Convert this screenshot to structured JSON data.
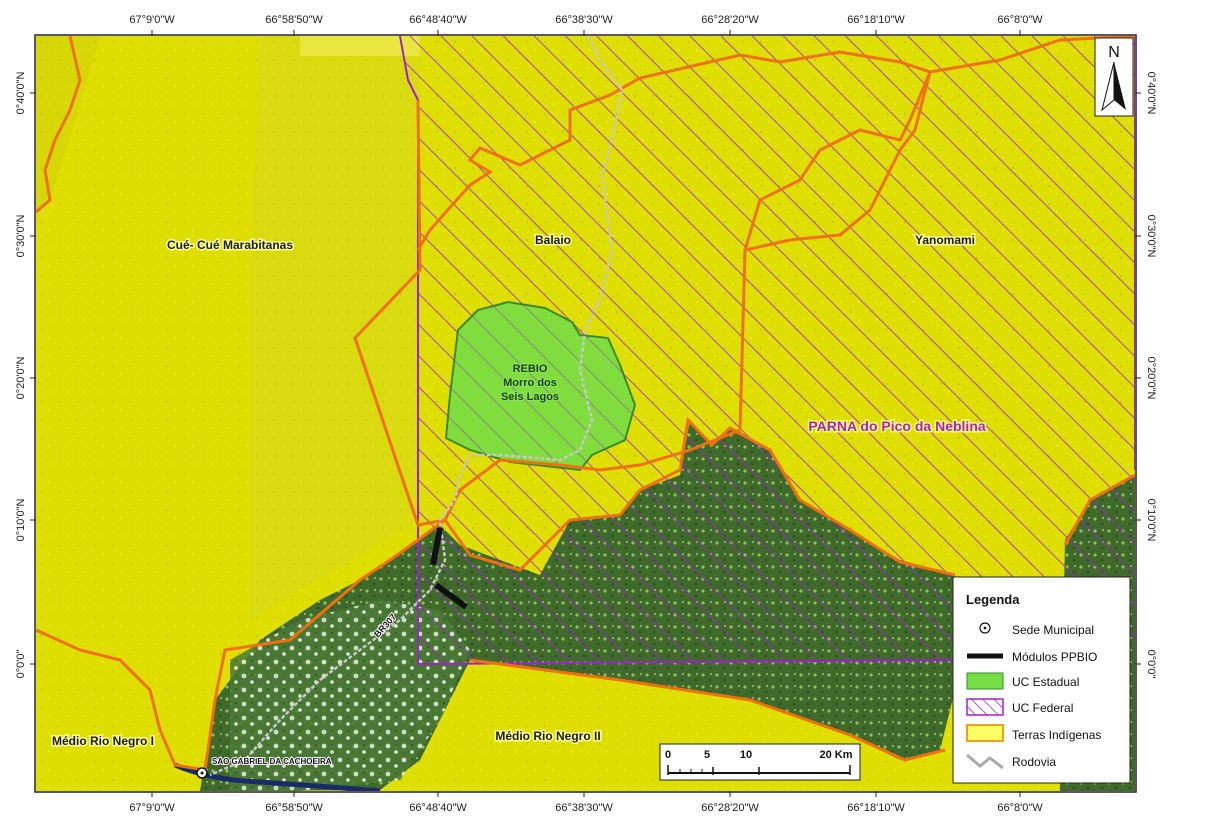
{
  "grid": {
    "top_longitudes": [
      "67°9'0\"W",
      "66°58'50\"W",
      "66°48'40\"W",
      "66°38'30\"W",
      "66°28'20\"W",
      "66°18'10\"W",
      "66°8'0\"W"
    ],
    "bottom_longitudes": [
      "67°9'0\"W",
      "66°58'50\"W",
      "66°48'40\"W",
      "66°38'30\"W",
      "66°28'20\"W",
      "66°18'10\"W",
      "66°8'0\"W"
    ],
    "left_latitudes": [
      "0°40'0\"N",
      "0°30'0\"N",
      "0°20'0\"N",
      "0°10'0\"N",
      "0°0'0\""
    ],
    "right_latitudes": [
      "0°40'0\"N",
      "0°30'0\"N",
      "0°20'0\"N",
      "0°10'0\"N",
      "0°0'0\""
    ]
  },
  "map_labels": {
    "cue_cue": "Cué- Cué Marabitanas",
    "balaio": "Balaio",
    "yanomami": "Yanomami",
    "rebio_1": "REBIO",
    "rebio_2": "Morro dos",
    "rebio_3": "Seis Lagos",
    "parna": "PARNA do Pico da Neblina",
    "medio_rio_negro_i": "Médio Rio Negro I",
    "medio_rio_negro_ii": "Médio Rio Negro II",
    "road": "BR307",
    "city": "SAO GABRIEL DA CACHOEIRA"
  },
  "north_arrow": {
    "letter": "N"
  },
  "scale_bar": {
    "ticks": [
      "0",
      "5",
      "10",
      "20 Km"
    ]
  },
  "legend": {
    "title": "Legenda",
    "items": [
      {
        "label": "Sede Municipal",
        "symbol": "point"
      },
      {
        "label": "Módulos PPBIO",
        "symbol": "thick-line"
      },
      {
        "label": "UC Estadual",
        "symbol": "green-fill"
      },
      {
        "label": "UC Federal",
        "symbol": "purple-hatch"
      },
      {
        "label": "Terras Indígenas",
        "symbol": "yellow-fill"
      },
      {
        "label": "Rodovia",
        "symbol": "gray-line"
      }
    ]
  },
  "colors": {
    "indigenous_fill": "#e0e000",
    "indigenous_border": "#f07010",
    "state_uc": "#77dd44",
    "federal_uc": "#a020d0",
    "forest": "#3f6a2c",
    "road": "#c8c8c8"
  }
}
